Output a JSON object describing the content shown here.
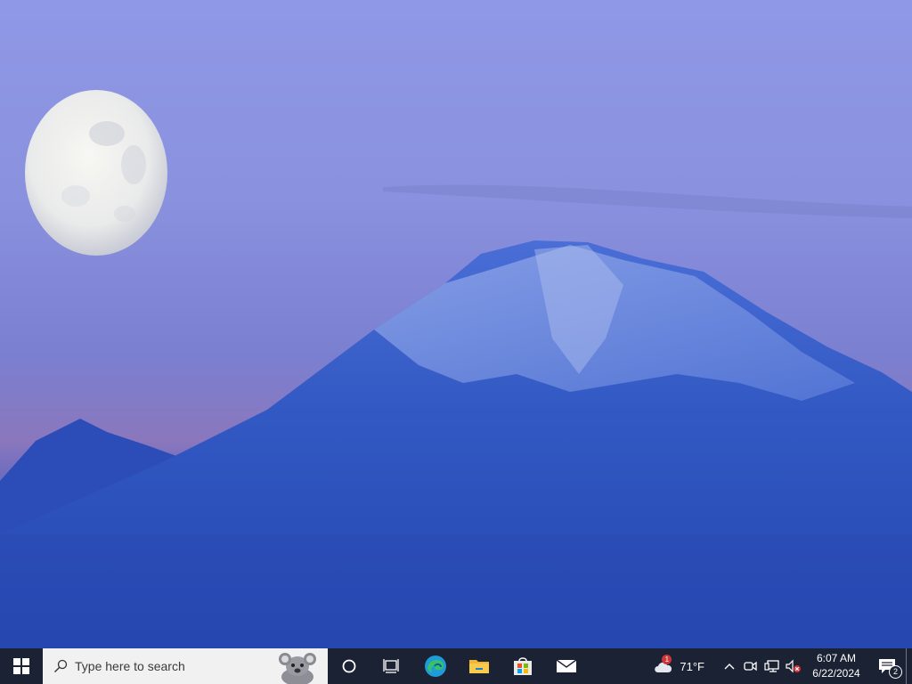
{
  "desktop": {
    "wallpaper": "moon-over-snowy-mountain",
    "colors": {
      "sky": "#8f98e6",
      "mountain": "#2e56c2",
      "snow": "#8fa6e8",
      "moon": "#f2f2ee"
    }
  },
  "taskbar": {
    "search": {
      "placeholder": "Type here to search",
      "mascot_icon": "koala-mascot-icon"
    },
    "pinned_apps": [
      {
        "name": "Microsoft Edge",
        "icon": "edge-icon"
      },
      {
        "name": "File Explorer",
        "icon": "folder-icon"
      },
      {
        "name": "Microsoft Store",
        "icon": "store-icon"
      },
      {
        "name": "Mail",
        "icon": "mail-icon"
      }
    ],
    "weather": {
      "temperature": "71°F",
      "badge": "1",
      "icon": "cloud-icon"
    },
    "clock": {
      "time": "6:07 AM",
      "date": "6/22/2024"
    },
    "notifications": {
      "count": "2"
    },
    "colors": {
      "background": "#1b2233",
      "search_bg": "#f1f1f1",
      "badge": "#d13438"
    }
  }
}
